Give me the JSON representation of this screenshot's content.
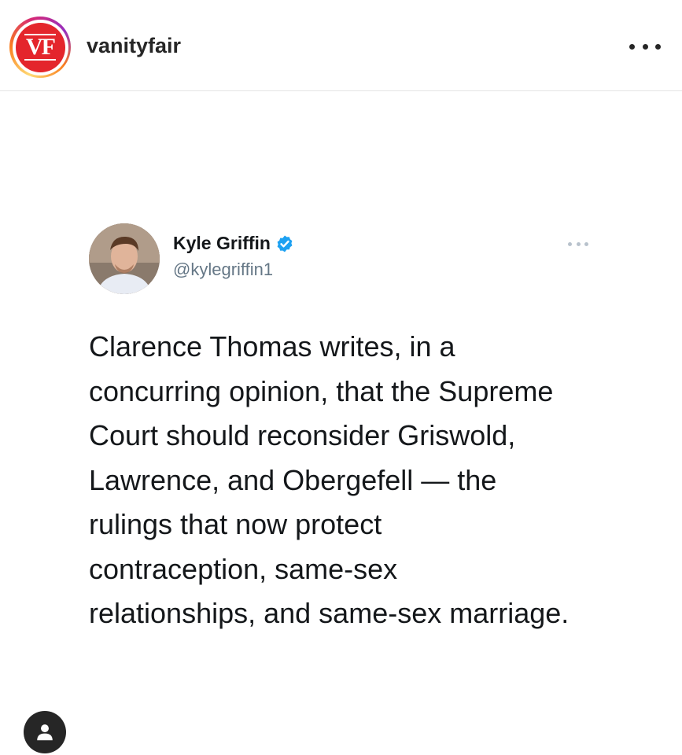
{
  "post": {
    "account_name": "vanityfair",
    "avatar_logo_text": "VF",
    "more_icon": "more-horizontal-icon"
  },
  "tweet": {
    "author_name": "Kyle Griffin",
    "author_handle": "@kylegriffin1",
    "verified": true,
    "text_lines": [
      "Clarence Thomas writes, in a",
      "concurring opinion, that the Supreme",
      "Court should reconsider Griswold,",
      "Lawrence, and Obergefell — the",
      "rulings that now protect",
      "contraception, same-sex",
      "relationships, and same-sex marriage."
    ]
  },
  "tag_icon": "user-tag-icon",
  "colors": {
    "brand_red": "#e4252c",
    "verified_blue": "#1da1f2",
    "text_dark": "#14171a",
    "handle_gray": "#657786"
  }
}
